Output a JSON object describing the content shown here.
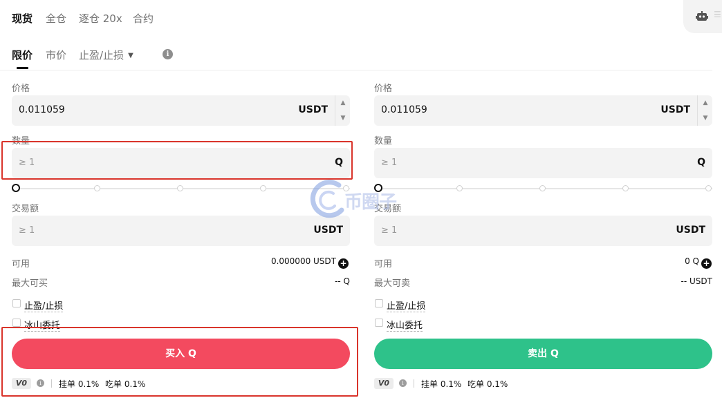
{
  "top_tabs": [
    {
      "label": "现货",
      "active": true
    },
    {
      "label": "全仓",
      "active": false
    },
    {
      "label": "逐仓 20x",
      "active": false
    },
    {
      "label": "合约",
      "active": false
    }
  ],
  "order_tabs": [
    {
      "label": "限价",
      "active": true
    },
    {
      "label": "市价",
      "active": false
    },
    {
      "label": "止盈/止损",
      "active": false
    }
  ],
  "buy": {
    "price_label": "价格",
    "price_value": "0.011059",
    "price_unit": "USDT",
    "amount_label": "数量",
    "amount_placeholder": "≥ 1",
    "amount_unit": "Q",
    "total_label": "交易额",
    "total_placeholder": "≥ 1",
    "total_unit": "USDT",
    "available_label": "可用",
    "available_value": "0.000000 USDT",
    "max_label": "最大可买",
    "max_value": "-- Q",
    "tpsl_label": "止盈/止损",
    "iceberg_label": "冰山委托",
    "button_label": "买入 Q",
    "vip_badge": "V0",
    "maker_fee": "挂单 0.1%",
    "taker_fee": "吃单 0.1%"
  },
  "sell": {
    "price_label": "价格",
    "price_value": "0.011059",
    "price_unit": "USDT",
    "amount_label": "数量",
    "amount_placeholder": "≥ 1",
    "amount_unit": "Q",
    "total_label": "交易额",
    "total_placeholder": "≥ 1",
    "total_unit": "USDT",
    "available_label": "可用",
    "available_value": "0 Q",
    "max_label": "最大可卖",
    "max_value": "-- USDT",
    "tpsl_label": "止盈/止损",
    "iceberg_label": "冰山委托",
    "button_label": "卖出 Q",
    "vip_badge": "V0",
    "maker_fee": "挂单 0.1%",
    "taker_fee": "吃单 0.1%"
  },
  "watermark_text": "币圈子",
  "icons": {
    "robot": "robot-icon",
    "info": "info-icon",
    "plus": "plus-circle-icon",
    "caret": "caret-down-icon"
  },
  "colors": {
    "buy": "#f34a5f",
    "sell": "#2ec28a",
    "highlight": "#d9342b"
  }
}
